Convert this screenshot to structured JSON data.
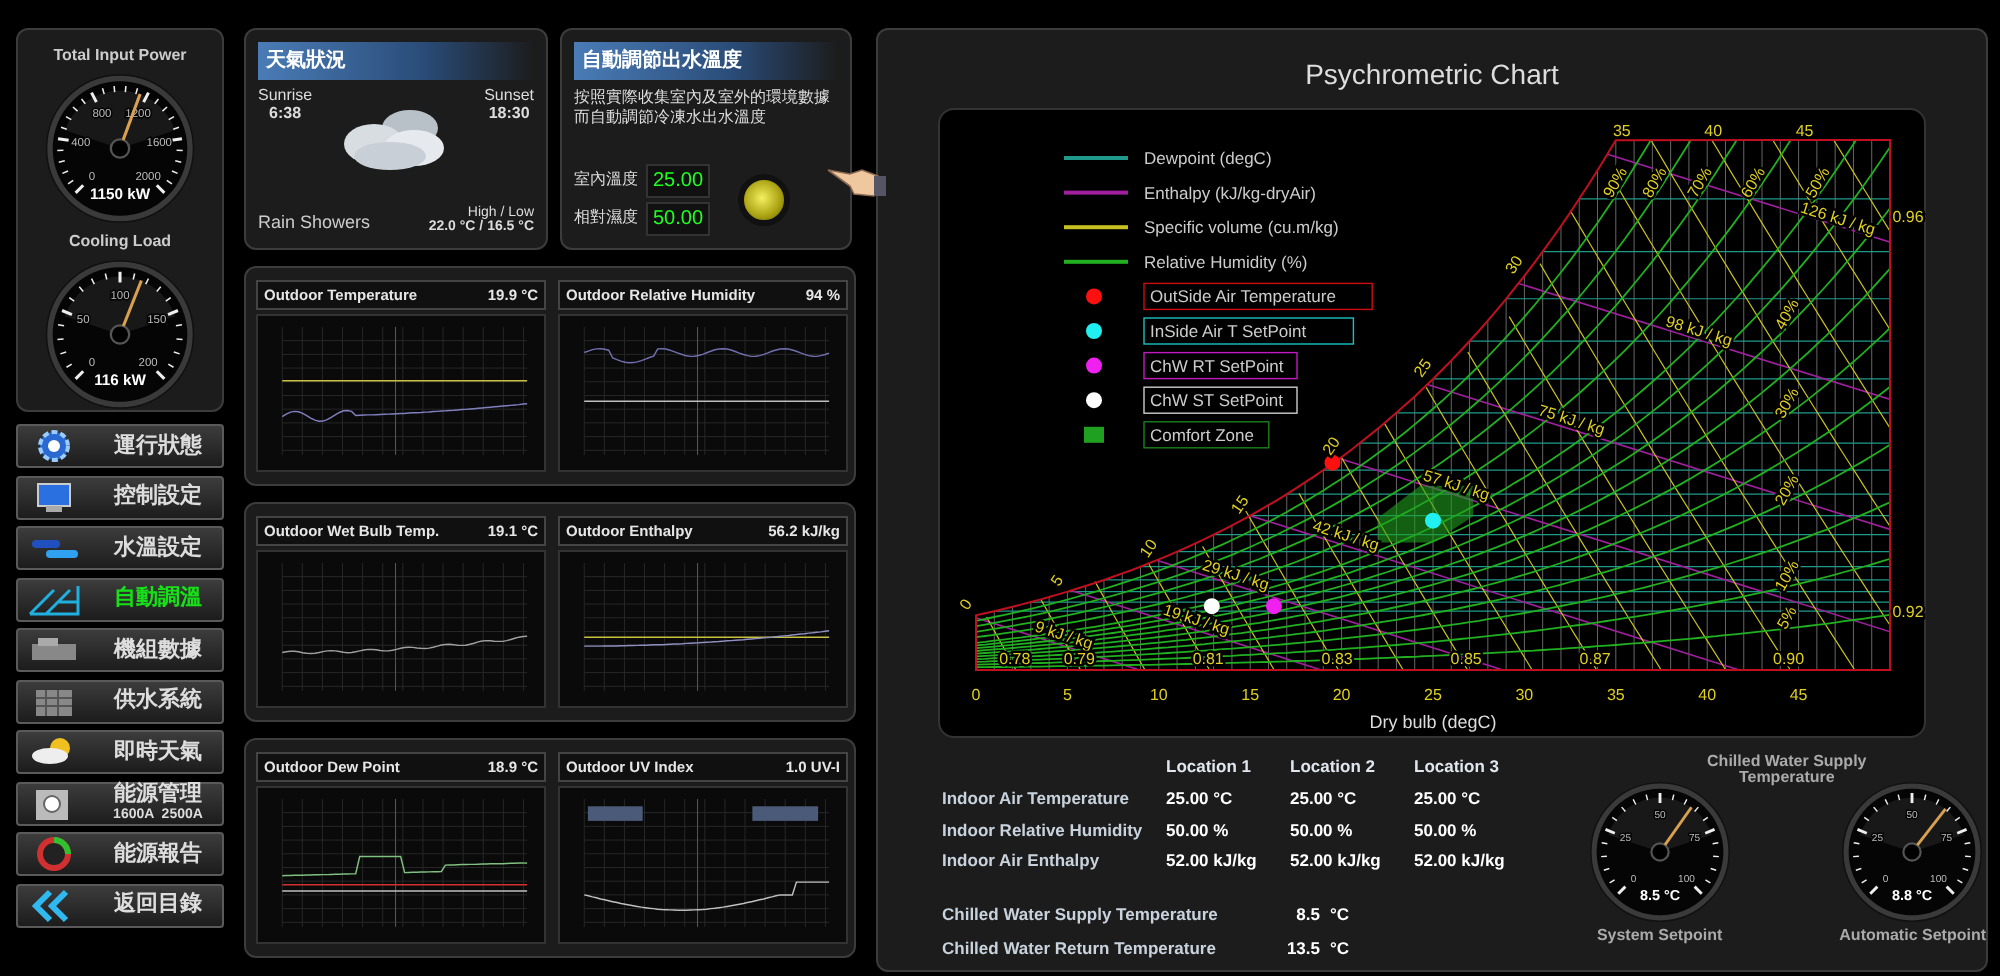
{
  "gauges_panel": {
    "gauges": [
      {
        "title": "Total Input Power",
        "scale": [
          "0",
          "400",
          "800",
          "1200",
          "1600",
          "2000"
        ],
        "level": 0.575,
        "reading": "1150 kW"
      },
      {
        "title": "Cooling Load",
        "scale": [
          "0",
          "50",
          "100",
          "150",
          "200"
        ],
        "level": 0.58,
        "reading": "116 kW"
      }
    ]
  },
  "nav": [
    {
      "label": "運行狀態",
      "selected": false
    },
    {
      "label": "控制設定",
      "selected": false
    },
    {
      "label": "水溫設定",
      "selected": false
    },
    {
      "label": "自動調溫",
      "selected": true
    },
    {
      "label": "機組數據",
      "selected": false
    },
    {
      "label": "供水系統",
      "selected": false
    },
    {
      "label": "即時天氣",
      "selected": false
    },
    {
      "label": "能源管理",
      "sublabels": [
        "1600A",
        "2500A"
      ],
      "selected": false
    },
    {
      "label": "能源報告",
      "selected": false
    },
    {
      "label": "返回目錄",
      "selected": false
    }
  ],
  "weather": {
    "title": "天氣狀況",
    "sunrise_label": "Sunrise",
    "sunrise": "6:38",
    "sunset_label": "Sunset",
    "sunset": "18:30",
    "condition": "Rain Showers",
    "high_low_label": "High / Low",
    "high_low": "22.0 °C / 16.5 °C"
  },
  "auto": {
    "title": "自動調節出水溫度",
    "description": "按照實際收集室內及室外的環境數據而自動調節冷凍水出水溫度",
    "fields": [
      {
        "label": "室內溫度",
        "value": "25.00"
      },
      {
        "label": "相對濕度",
        "value": "50.00"
      }
    ]
  },
  "trend_panels": [
    {
      "charts": [
        {
          "title": "Outdoor Temperature",
          "reading": "19.9 °C"
        },
        {
          "title": "Outdoor Relative Humidity",
          "reading": "94 %"
        }
      ]
    },
    {
      "charts": [
        {
          "title": "Outdoor Wet Bulb Temp.",
          "reading": "19.1 °C"
        },
        {
          "title": "Outdoor Enthalpy",
          "reading": "56.2 kJ/kg"
        }
      ]
    },
    {
      "charts": [
        {
          "title": "Outdoor Dew Point",
          "reading": "18.9 °C"
        },
        {
          "title": "Outdoor UV Index",
          "reading": "1.0 UV-I"
        }
      ]
    }
  ],
  "psychro": {
    "title": "Psychrometric Chart",
    "legend": [
      {
        "kind": "dewpoint",
        "color": "#1f9a8a",
        "label": "Dewpoint (degC)"
      },
      {
        "kind": "enthalpy",
        "color": "#a020a0",
        "label": "Enthalpy (kJ/kg-dryAir)"
      },
      {
        "kind": "volume",
        "color": "#c8c020",
        "label": "Specific volume (cu.m/kg)"
      },
      {
        "kind": "rh",
        "color": "#20b020",
        "label": "Relative Humidity (%)"
      },
      {
        "kind": "point",
        "color": "#ff1010",
        "label": "OutSide Air Temperature"
      },
      {
        "kind": "point",
        "color": "#20f0f0",
        "label": "InSide Air T SetPoint"
      },
      {
        "kind": "point",
        "color": "#f020f0",
        "label": "ChW RT SetPoint"
      },
      {
        "kind": "point",
        "color": "#ffffff",
        "label": "ChW ST SetPoint"
      },
      {
        "kind": "zone",
        "color": "#20a020",
        "label": "Comfort Zone"
      }
    ],
    "saturation_labels": [
      "0",
      "5",
      "10",
      "15",
      "20",
      "25",
      "30"
    ],
    "top_labels": [
      "35",
      "40",
      "45"
    ],
    "enthalpy_labels": [
      "9 kJ / kg",
      "19 kJ / kg",
      "29 kJ / kg",
      "42 kJ / kg",
      "57 kJ / kg",
      "75 kJ / kg",
      "98 kJ / kg",
      "126 kJ / kg"
    ],
    "rh_labels": [
      "90%",
      "80%",
      "70%",
      "60%",
      "50%",
      "40%",
      "30%",
      "20%",
      "10%",
      "5%"
    ],
    "volume_labels": [
      "0.78",
      "0.79",
      "0.81",
      "0.83",
      "0.85",
      "0.87",
      "0.90",
      "0.92",
      "0.96"
    ],
    "xticks": [
      "0",
      "5",
      "10",
      "15",
      "20",
      "25",
      "30",
      "35",
      "40",
      "45"
    ],
    "xlabel": "Dry bulb (degC)"
  },
  "table": {
    "columns": [
      "Location 1",
      "Location 2",
      "Location 3"
    ],
    "rows": [
      {
        "label": "Indoor Air Temperature",
        "values": [
          "25.00 °C",
          "25.00 °C",
          "25.00 °C"
        ]
      },
      {
        "label": "Indoor Relative Humidity",
        "values": [
          "50.00 %",
          "50.00 %",
          "50.00 %"
        ]
      },
      {
        "label": "Indoor Air Enthalpy",
        "values": [
          "52.00 kJ/kg",
          "52.00 kJ/kg",
          "52.00 kJ/kg"
        ]
      }
    ],
    "chilled_water": [
      {
        "label": "Chilled Water Supply Temperature",
        "value": "8.5",
        "unit": "°C"
      },
      {
        "label": "Chilled Water Return Temperature",
        "value": "13.5",
        "unit": "°C"
      }
    ]
  },
  "setpoints": {
    "title": "Chilled Water Supply Temperature",
    "gauges": [
      {
        "scale": [
          "0",
          "25",
          "50",
          "75",
          "100"
        ],
        "level": 0.63,
        "reading": "8.5 °C",
        "caption": "System Setpoint"
      },
      {
        "scale": [
          "0",
          "25",
          "50",
          "75",
          "100"
        ],
        "level": 0.64,
        "reading": "8.8 °C",
        "caption": "Automatic Setpoint"
      }
    ]
  }
}
